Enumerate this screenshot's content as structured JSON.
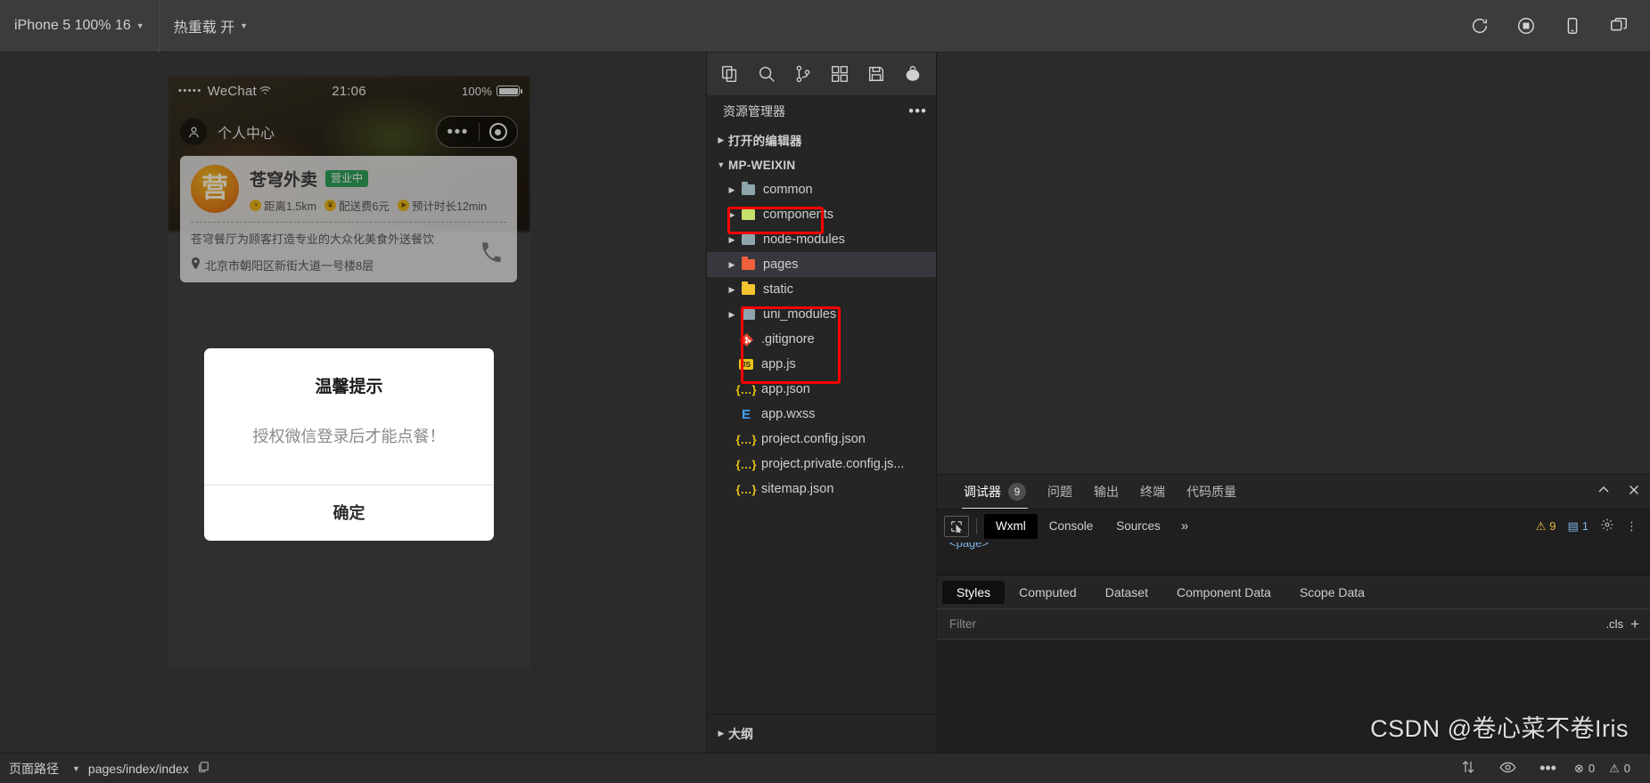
{
  "toolbar": {
    "device_selector": "iPhone 5 100% 16",
    "hot_reload": "热重载 开",
    "icons": [
      "refresh-icon",
      "stop-icon",
      "mobile-icon",
      "window-icon"
    ]
  },
  "simulator": {
    "status_bar": {
      "carrier": "WeChat",
      "dots": "•••••",
      "wifi": "⌃",
      "time": "21:06",
      "battery_label": "100%"
    },
    "nav": {
      "avatar_icon": "person-icon",
      "title": "个人中心",
      "capsule_dots": "•••",
      "capsule_target": "target-icon"
    },
    "shop": {
      "logo_text": "营",
      "name": "苍穹外卖",
      "status_badge": "营业中",
      "meta": [
        {
          "icon": "clock-icon",
          "glyph": "◔",
          "text": "距离1.5km"
        },
        {
          "icon": "yuan-icon",
          "glyph": "¥",
          "text": "配送费6元"
        },
        {
          "icon": "nav-arrow-icon",
          "glyph": "➤",
          "text": "预计时长12min"
        }
      ],
      "description": "苍穹餐厅为顾客打造专业的大众化美食外送餐饮",
      "address": "北京市朝阳区新街大道一号楼8层",
      "address_icon": "location-pin-icon",
      "phone_icon": "phone-icon"
    },
    "modal": {
      "title": "温馨提示",
      "message": "授权微信登录后才能点餐！",
      "confirm_label": "确定"
    }
  },
  "activity_bar": {
    "icons": [
      "explorer-icon",
      "search-icon",
      "source-control-icon",
      "extensions-icon",
      "save-all-icon",
      "uniapp-icon"
    ]
  },
  "explorer": {
    "header": "资源管理器",
    "more_icon": "ellipsis-icon",
    "sections": [
      {
        "label": "打开的编辑器",
        "expanded": false
      },
      {
        "label": "MP-WEIXIN",
        "expanded": true
      }
    ],
    "items": [
      {
        "label": "common",
        "icon": "folder-icon",
        "color": "gray",
        "type": "folder",
        "arrow": true,
        "highlighted": false
      },
      {
        "label": "components",
        "icon": "folder-components-icon",
        "color": "green",
        "type": "folder",
        "arrow": true,
        "highlighted": false
      },
      {
        "label": "node-modules",
        "icon": "folder-icon",
        "color": "gray",
        "type": "folder",
        "arrow": true,
        "highlighted": false
      },
      {
        "label": "pages",
        "icon": "folder-pages-icon",
        "color": "red",
        "type": "folder",
        "arrow": true,
        "highlighted": true,
        "selected": true
      },
      {
        "label": "static",
        "icon": "folder-static-icon",
        "color": "yellow",
        "type": "folder",
        "arrow": true,
        "highlighted": false
      },
      {
        "label": "uni_modules",
        "icon": "folder-icon",
        "color": "gray",
        "type": "folder",
        "arrow": true,
        "highlighted": false
      },
      {
        "label": ".gitignore",
        "icon": "git-icon",
        "type": "file",
        "arrow": false,
        "highlighted": false
      },
      {
        "label": "app.js",
        "icon": "js-icon",
        "type": "file",
        "arrow": false,
        "highlighted": true
      },
      {
        "label": "app.json",
        "icon": "json-icon",
        "type": "file",
        "arrow": false,
        "highlighted": true
      },
      {
        "label": "app.wxss",
        "icon": "css-icon",
        "type": "file",
        "arrow": false,
        "highlighted": true
      },
      {
        "label": "project.config.json",
        "icon": "json-icon",
        "type": "file",
        "arrow": false,
        "highlighted": false
      },
      {
        "label": "project.private.config.js...",
        "icon": "json-icon",
        "type": "file",
        "arrow": false,
        "highlighted": false
      },
      {
        "label": "sitemap.json",
        "icon": "json-icon",
        "type": "file",
        "arrow": false,
        "highlighted": false
      }
    ],
    "outline": {
      "label": "大纲",
      "expanded": false
    }
  },
  "devtools": {
    "panel_tabs": [
      {
        "label": "调试器",
        "count": "9",
        "active": true
      },
      {
        "label": "问题",
        "active": false
      },
      {
        "label": "输出",
        "active": false
      },
      {
        "label": "终端",
        "active": false
      },
      {
        "label": "代码质量",
        "active": false
      }
    ],
    "collapse_icon": "chevron-up-icon",
    "close_icon": "close-icon",
    "inspector_tabs": [
      {
        "label": "Wxml",
        "selected": true
      },
      {
        "label": "Console",
        "selected": false
      },
      {
        "label": "Sources",
        "selected": false
      }
    ],
    "overflow_icon": "chevrons-right-icon",
    "picker_icon": "element-picker-icon",
    "warn_count": "9",
    "info_count": "1",
    "settings_icon": "gear-icon",
    "menu_icon": "kebab-menu-icon",
    "dom_snippet": "<page>",
    "style_tabs": [
      {
        "label": "Styles",
        "selected": true
      },
      {
        "label": "Computed",
        "selected": false
      },
      {
        "label": "Dataset",
        "selected": false
      },
      {
        "label": "Component Data",
        "selected": false
      },
      {
        "label": "Scope Data",
        "selected": false
      }
    ],
    "filter_placeholder": "Filter",
    "filter_value": "",
    "cls_label": ".cls",
    "add_rule_icon": "plus-icon"
  },
  "status_bar": {
    "page_path_label": "页面路径",
    "page_path": "pages/index/index",
    "copy_icon": "copy-icon",
    "icons": [
      "compare-icon",
      "eye-icon",
      "ellipsis-icon"
    ],
    "errors": "0",
    "warnings": "0",
    "error_icon": "error-icon",
    "warn_icon": "warning-icon"
  },
  "watermark": "CSDN @卷心菜不卷Iris",
  "colors": {
    "accent_red": "#ff0000",
    "badge_green": "#2e9e56",
    "panel_bg": "#252526",
    "editor_bg": "#1e1e1e",
    "toolbar_bg": "#3c3c3c"
  }
}
